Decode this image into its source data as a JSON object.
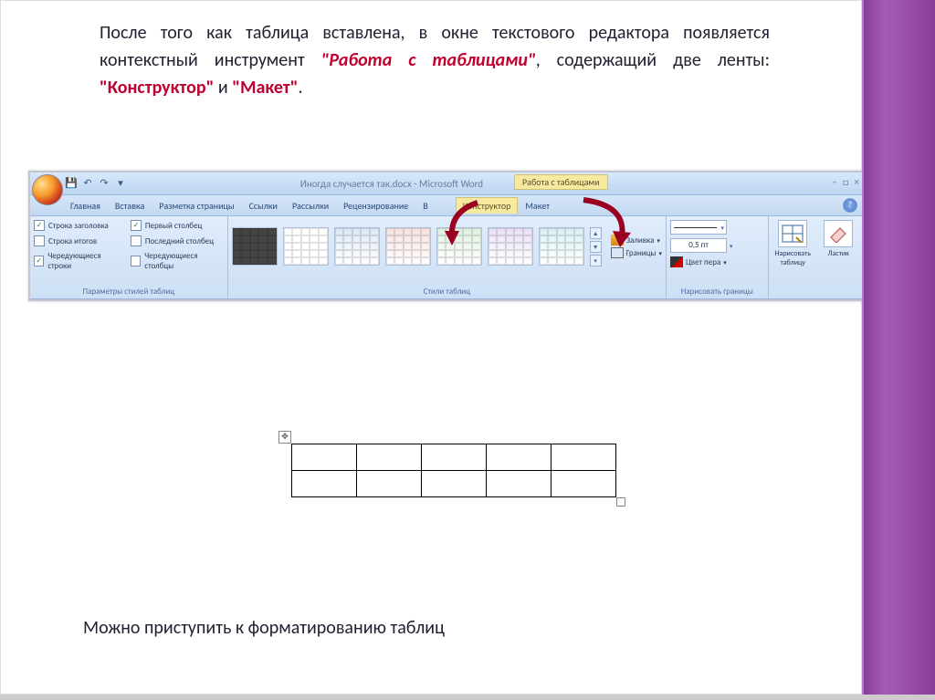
{
  "paragraph": {
    "part1": "После того как таблица вставлена, в окне текстового редактора появляется контекстный инструмент ",
    "highlight1": "\"Работа с таблицами\"",
    "part2": ", содержащий две ленты: ",
    "highlight2": "\"Конструктор\"",
    "part3": " и ",
    "highlight3": "\"Макет\"",
    "part4": "."
  },
  "bottom_line": "Можно приступить к форматированию таблиц",
  "word": {
    "doc_title": "Иногда случается так.docx - Microsoft Word",
    "context_tool": "Работа с таблицами",
    "tabs": {
      "home": "Главная",
      "insert": "Вставка",
      "layout_page": "Разметка страницы",
      "refs": "Ссылки",
      "mail": "Рассылки",
      "review": "Рецензирование",
      "view": "В",
      "design": "Конструктор",
      "tlayout": "Макет"
    },
    "group_opts": {
      "label": "Параметры стилей таблиц",
      "header_row": "Строка заголовка",
      "total_row": "Строка итогов",
      "banded_rows": "Чередующиеся строки",
      "first_col": "Первый столбец",
      "last_col": "Последний столбец",
      "banded_cols": "Чередующиеся столбцы"
    },
    "group_styles": {
      "label": "Стили таблиц",
      "fill": "Заливка",
      "borders": "Границы"
    },
    "group_lines": {
      "label": "Нарисовать границы",
      "weight": "0,5 пт",
      "pen_color": "Цвет пера"
    },
    "group_draw": {
      "draw": "Нарисовать таблицу",
      "eraser": "Ластик"
    }
  }
}
